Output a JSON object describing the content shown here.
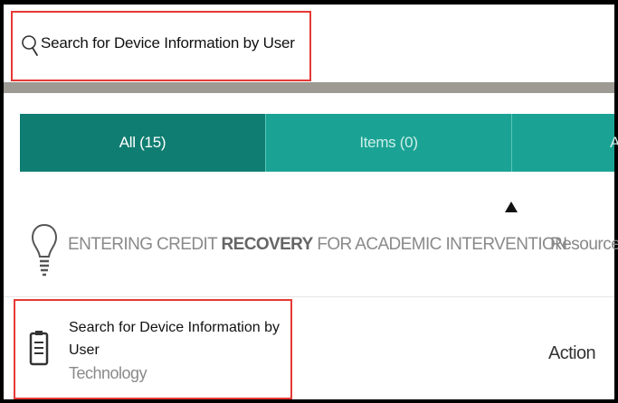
{
  "search": {
    "text": "Search for Device Information by User",
    "icon": "search-icon"
  },
  "tabs": [
    {
      "label": "All (15)",
      "active": true
    },
    {
      "label": "Items (0)",
      "active": false
    },
    {
      "label": "A",
      "active": false
    }
  ],
  "results": [
    {
      "icon": "lightbulb-icon",
      "title_pre": "ENTERING CREDIT ",
      "title_bold": "RECOVERY",
      "title_post": " FOR ACADEMIC INTERVENTION",
      "type": "Resource"
    },
    {
      "icon": "clipboard-icon",
      "title": "Search for Device Information by User",
      "category": "Technology",
      "type": "Action"
    }
  ],
  "colors": {
    "tab_bg": "#1aa394",
    "tab_active_bg": "#0f7d71",
    "highlight": "#e53935"
  }
}
